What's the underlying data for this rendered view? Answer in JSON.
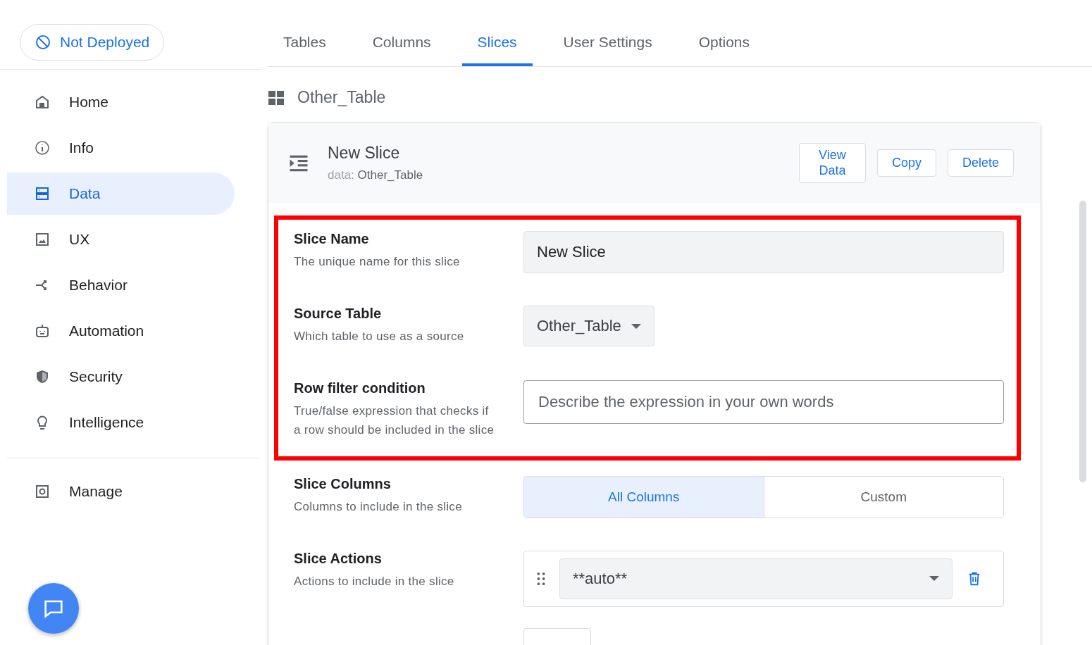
{
  "deploy_status": {
    "label": "Not Deployed"
  },
  "sidebar": {
    "items": [
      {
        "label": "Home",
        "selected": false
      },
      {
        "label": "Info",
        "selected": false
      },
      {
        "label": "Data",
        "selected": true
      },
      {
        "label": "UX",
        "selected": false
      },
      {
        "label": "Behavior",
        "selected": false
      },
      {
        "label": "Automation",
        "selected": false
      },
      {
        "label": "Security",
        "selected": false
      },
      {
        "label": "Intelligence",
        "selected": false
      }
    ],
    "footer_items": [
      {
        "label": "Manage",
        "selected": false
      }
    ]
  },
  "tabs": [
    {
      "label": "Tables",
      "selected": false
    },
    {
      "label": "Columns",
      "selected": false
    },
    {
      "label": "Slices",
      "selected": true
    },
    {
      "label": "User Settings",
      "selected": false
    },
    {
      "label": "Options",
      "selected": false
    }
  ],
  "table_title": "Other_Table",
  "slice": {
    "title": "New Slice",
    "source_prefix": "data:",
    "source": "Other_Table",
    "buttons": [
      "View Data",
      "Copy",
      "Delete"
    ],
    "fields": [
      {
        "kind": "text",
        "label": "Slice Name",
        "description": "The unique name for this slice",
        "value": "New Slice",
        "highlighted": true
      },
      {
        "kind": "dropdown",
        "label": "Source Table",
        "description": "Which table to use as a source",
        "value": "Other_Table",
        "highlighted": true
      },
      {
        "kind": "input",
        "label": "Row filter condition",
        "description": "True/false expression that checks if a row should be included in the slice",
        "placeholder": "Describe the expression in your own words",
        "highlighted": true
      },
      {
        "kind": "segmented",
        "label": "Slice Columns",
        "description": "Columns to include in the slice",
        "options": [
          {
            "label": "All Columns",
            "selected": true
          },
          {
            "label": "Custom",
            "selected": false
          }
        ],
        "highlighted": false
      },
      {
        "kind": "list",
        "label": "Slice Actions",
        "description": "Actions to include in the slice",
        "value": "**auto**",
        "highlighted": false
      }
    ]
  }
}
